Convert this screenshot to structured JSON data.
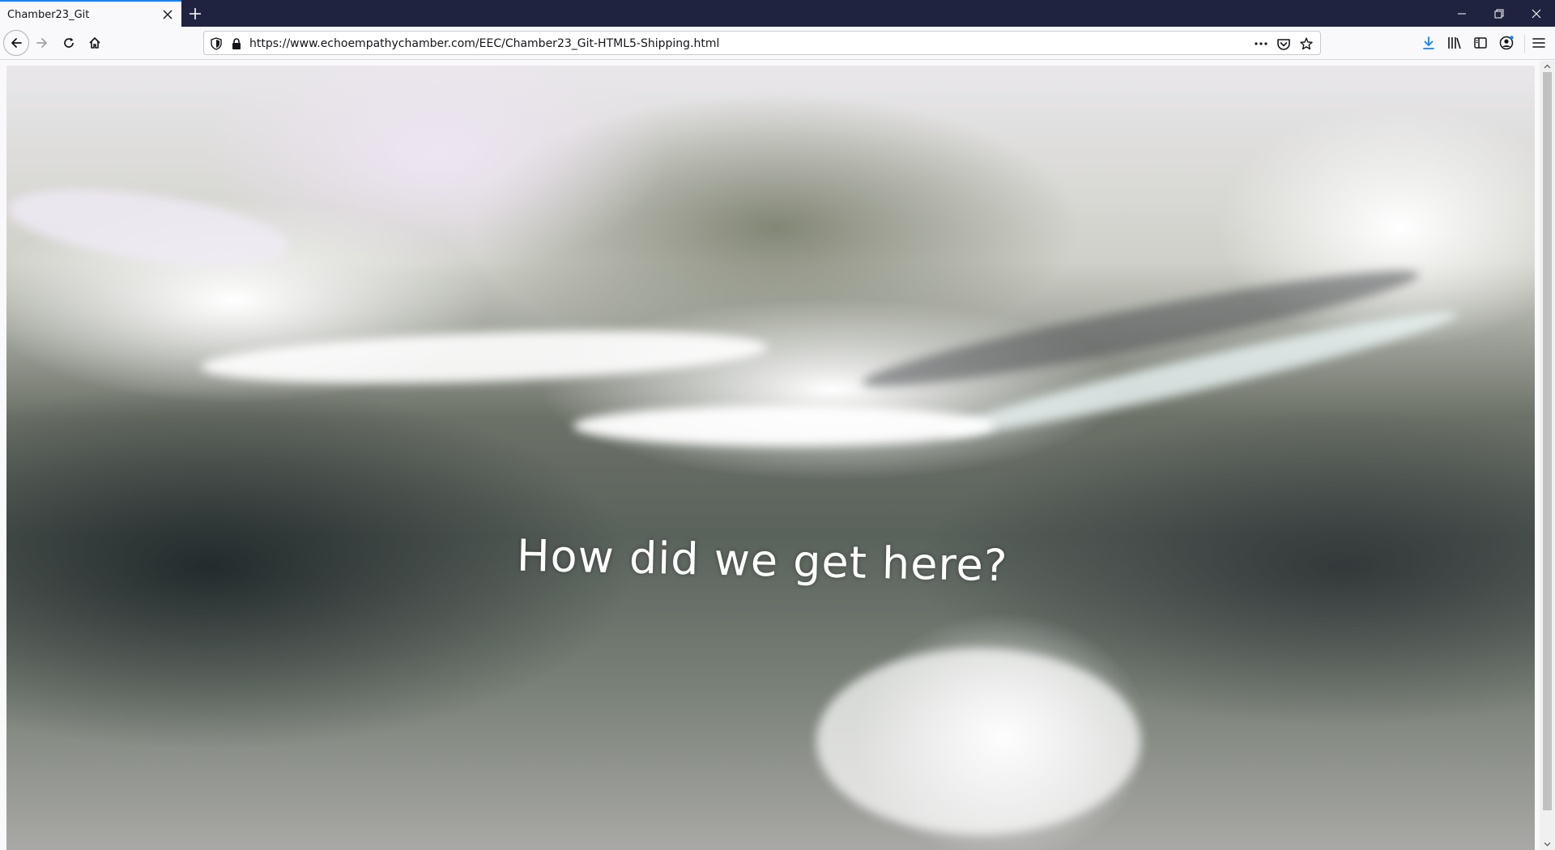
{
  "browser": {
    "tab_title": "Chamber23_Git",
    "url": "https://www.echoempathychamber.com/EEC/Chamber23_Git-HTML5-Shipping.html"
  },
  "icons": {
    "tab_close": "close-icon",
    "new_tab": "plus-icon",
    "minimize": "minimize-icon",
    "restore": "restore-icon",
    "close_window": "close-icon",
    "back": "arrow-left-icon",
    "forward": "arrow-right-icon",
    "reload": "reload-icon",
    "home": "home-icon",
    "tracking": "shield-icon",
    "lock": "lock-icon",
    "page_actions": "more-icon",
    "pocket": "pocket-icon",
    "bookmark": "star-icon",
    "downloads": "download-icon",
    "library": "library-icon",
    "sidebar": "sidebar-icon",
    "account": "account-icon",
    "menu": "hamburger-icon"
  },
  "page": {
    "caption": "How did we get here?"
  },
  "colors": {
    "titlebar": "#202340",
    "accent": "#0a84ff",
    "toolbar": "#f9f9fb",
    "download_accent": "#0a84ff"
  }
}
